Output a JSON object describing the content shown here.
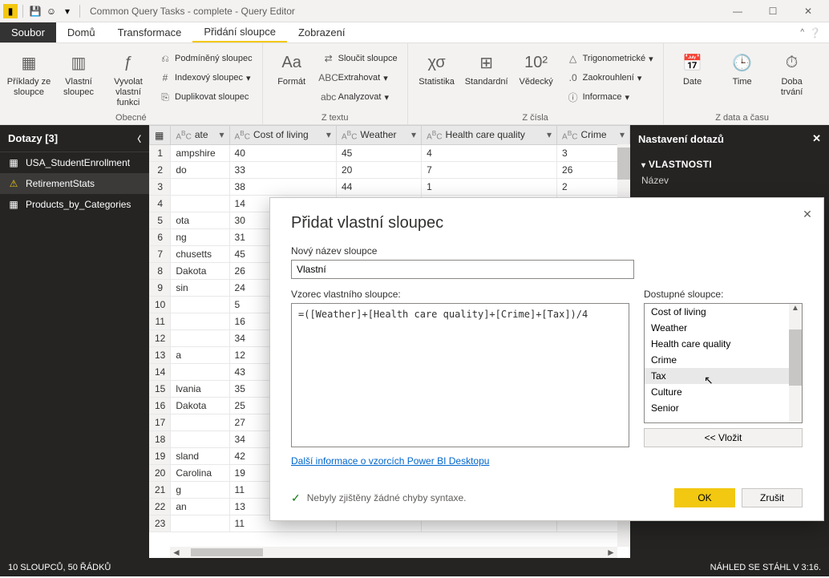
{
  "title": "Common Query Tasks - complete - Query Editor",
  "menu": {
    "file": "Soubor",
    "home": "Domů",
    "transform": "Transformace",
    "addcol": "Přidání sloupce",
    "view": "Zobrazení"
  },
  "ribbon": {
    "g1": {
      "examples": "Příklady ze sloupce",
      "custom": "Vlastní sloupec",
      "invoke": "Vyvolat vlastní funkci",
      "cond": "Podmíněný sloupec",
      "index": "Indexový sloupec",
      "dup": "Duplikovat sloupec",
      "label": "Obecné"
    },
    "g2": {
      "format": "Formát",
      "merge": "Sloučit sloupce",
      "extract": "Extrahovat",
      "analyze": "Analyzovat",
      "label": "Z textu"
    },
    "g3": {
      "stats": "Statistika",
      "standard": "Standardní",
      "sci": "Vědecký",
      "trig": "Trigonometrické",
      "round": "Zaokrouhlení",
      "info": "Informace",
      "label": "Z čísla"
    },
    "g4": {
      "date": "Date",
      "time": "Time",
      "duration": "Doba trvání",
      "label": "Z data a času"
    }
  },
  "queries": {
    "header": "Dotazy [3]",
    "items": [
      "USA_StudentEnrollment",
      "RetirementStats",
      "Products_by_Categories"
    ]
  },
  "table": {
    "headers": [
      "ate",
      "Cost of living",
      "Weather",
      "Health care quality",
      "Crime"
    ],
    "rows": [
      [
        "1",
        "ampshire",
        "40",
        "45",
        "4",
        "3"
      ],
      [
        "2",
        "do",
        "33",
        "20",
        "7",
        "26"
      ],
      [
        "3",
        "",
        "38",
        "44",
        "1",
        "2"
      ],
      [
        "4",
        "",
        "14",
        "",
        "",
        ""
      ],
      [
        "5",
        "ota",
        "30",
        "",
        "",
        ""
      ],
      [
        "6",
        "ng",
        "31",
        "",
        "",
        ""
      ],
      [
        "7",
        "chusetts",
        "45",
        "",
        "",
        ""
      ],
      [
        "8",
        "Dakota",
        "26",
        "",
        "",
        ""
      ],
      [
        "9",
        "sin",
        "24",
        "",
        "",
        ""
      ],
      [
        "10",
        "",
        "5",
        "",
        "",
        ""
      ],
      [
        "11",
        "",
        "16",
        "",
        "",
        ""
      ],
      [
        "12",
        "",
        "34",
        "",
        "",
        ""
      ],
      [
        "13",
        "a",
        "12",
        "",
        "",
        ""
      ],
      [
        "14",
        "",
        "43",
        "",
        "",
        ""
      ],
      [
        "15",
        "lvania",
        "35",
        "",
        "",
        ""
      ],
      [
        "16",
        "Dakota",
        "25",
        "",
        "",
        ""
      ],
      [
        "17",
        "",
        "27",
        "",
        "",
        ""
      ],
      [
        "18",
        "",
        "34",
        "",
        "",
        ""
      ],
      [
        "19",
        "sland",
        "42",
        "",
        "",
        ""
      ],
      [
        "20",
        "Carolina",
        "19",
        "",
        "",
        ""
      ],
      [
        "21",
        "g",
        "11",
        "",
        "",
        ""
      ],
      [
        "22",
        "an",
        "13",
        "",
        "",
        ""
      ],
      [
        "23",
        "",
        "11",
        "",
        "",
        ""
      ]
    ]
  },
  "settings": {
    "header": "Nastavení dotazů",
    "properties": "VLASTNOSTI",
    "name": "Název"
  },
  "status": {
    "left": "10 SLOUPCŮ, 50 ŘÁDKŮ",
    "right": "NÁHLED SE STÁHL V 3:16."
  },
  "dialog": {
    "title": "Přidat vlastní sloupec",
    "newnameLabel": "Nový název sloupce",
    "newname": "Vlastní",
    "formulaLabel": "Vzorec vlastního sloupce:",
    "formula": "=([Weather]+[Health care quality]+[Crime]+[Tax])/4",
    "availLabel": "Dostupné sloupce:",
    "available": [
      "Cost of living",
      "Weather",
      "Health care quality",
      "Crime",
      "Tax",
      "Culture",
      "Senior"
    ],
    "insert": "<< Vložit",
    "learn": "Další informace o vzorcích Power BI Desktopu",
    "syntax": "Nebyly zjištěny žádné chyby syntaxe.",
    "ok": "OK",
    "cancel": "Zrušit"
  }
}
